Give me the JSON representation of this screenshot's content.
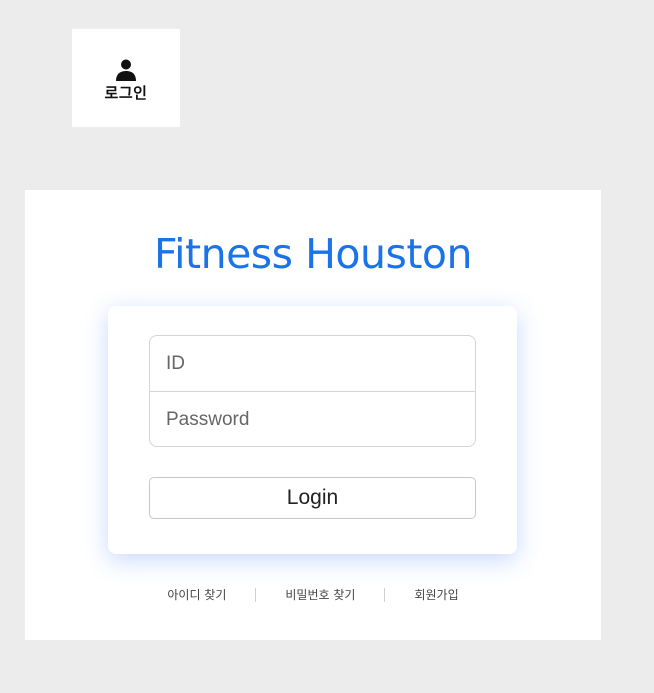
{
  "login_tile": {
    "icon": "person-icon",
    "label": "로그인"
  },
  "brand": {
    "title": "Fitness Houston",
    "color": "#1a73e8"
  },
  "form": {
    "id_placeholder": "ID",
    "password_placeholder": "Password",
    "login_button_label": "Login"
  },
  "footer_links": {
    "find_id": "아이디 찾기",
    "find_password": "비밀번호 찾기",
    "sign_up": "회원가입"
  }
}
